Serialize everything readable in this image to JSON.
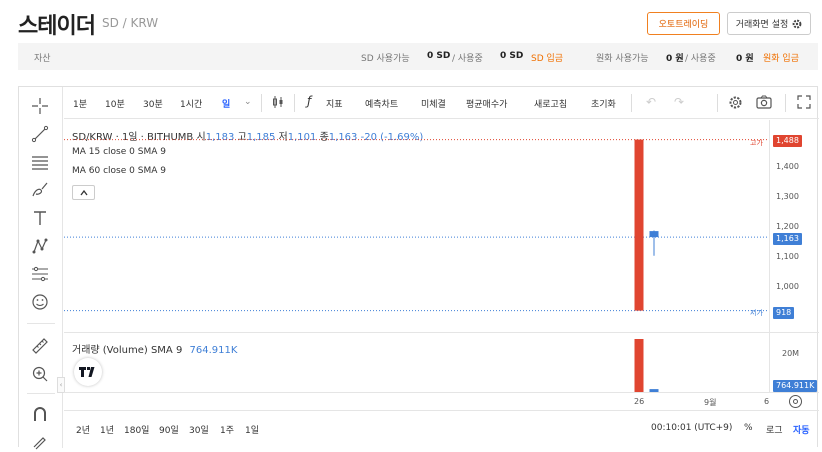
{
  "header": {
    "title": "스테이더",
    "symbol": "SD / KRW",
    "auto_trading": "오토트레이딩",
    "settings": "거래화면 설정"
  },
  "assets": {
    "label": "자산",
    "sd_avail_label": "SD 사용가능",
    "sd_avail": "0 SD",
    "sd_used_label": "/ 사용중",
    "sd_used": "0 SD",
    "sd_deposit": "SD 입금",
    "krw_avail_label": "원화 사용가능",
    "krw_avail": "0 원",
    "krw_used_label": "/ 사용중",
    "krw_used": "0 원",
    "krw_deposit": "원화 입금"
  },
  "toolbar": {
    "intervals": [
      "1분",
      "10분",
      "30분",
      "1시간",
      "일"
    ],
    "indicator": "지표",
    "forecast": "예측차트",
    "undecided": "미체결",
    "avg_price": "평균매수가",
    "refresh": "새로고침",
    "reset": "초기화"
  },
  "legend": {
    "pair": "SD/KRW · 1일 · BITHUMB",
    "o_label": "시",
    "o": "1,183",
    "h_label": "고",
    "h": "1,185",
    "l_label": "저",
    "l": "1,101",
    "c_label": "종",
    "c": "1,163",
    "chg": "-20 (-1.69%)",
    "ma15": "MA 15 close 0 SMA 9",
    "ma60": "MA 60 close 0 SMA 9",
    "volume_label": "거래량 (Volume) SMA 9",
    "volume_value": "764.911K"
  },
  "yaxis": {
    "ticks": [
      "1,400",
      "1,300",
      "1,200",
      "1,100",
      "1,000"
    ],
    "high_label": "고가",
    "high": "1,488",
    "current": "1,163",
    "low_label": "저가",
    "low": "918",
    "vol_tick": "20M",
    "vol_current": "764.911K"
  },
  "xaxis": {
    "ticks": [
      "26",
      "9월",
      "6"
    ]
  },
  "ranges": {
    "items": [
      "2년",
      "1년",
      "180일",
      "90일",
      "30일",
      "1주",
      "1일"
    ],
    "time": "00:10:01 (UTC+9)",
    "pct": "%",
    "log": "로그",
    "auto": "자동"
  },
  "colors": {
    "accent": "#f07000",
    "up": "#e04530",
    "down": "#3f7fd6"
  },
  "chart_data": {
    "type": "candlestick",
    "candles": [
      {
        "o": 1488,
        "h": 1488,
        "l": 918,
        "c": 918
      },
      {
        "o": 1183,
        "h": 1185,
        "l": 1101,
        "c": 1163
      }
    ],
    "volume": [
      {
        "v": 21000000
      },
      {
        "v": 764911
      }
    ]
  }
}
